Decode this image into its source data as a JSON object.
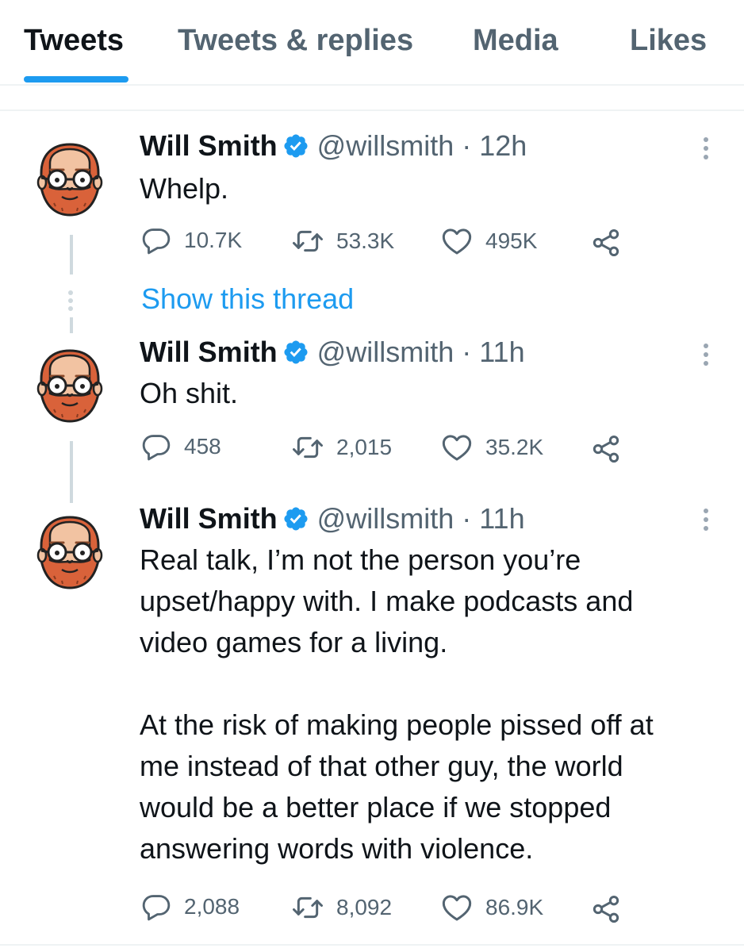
{
  "tabs": [
    "Tweets",
    "Tweets & replies",
    "Media",
    "Likes"
  ],
  "tweets": [
    {
      "name": "Will Smith",
      "handle_time": "@willsmith · 12h",
      "text": "Whelp.",
      "replies": "10.7K",
      "retweets": "53.3K",
      "likes": "495K"
    },
    {
      "name": "Will Smith",
      "handle_time": "@willsmith · 11h",
      "text": "Oh shit.",
      "replies": "458",
      "retweets": "2,015",
      "likes": "35.2K"
    },
    {
      "name": "Will Smith",
      "handle_time": "@willsmith · 11h",
      "text": "Real talk, I’m not the person you’re\nupset/happy with. I make podcasts and\nvideo games for a living.\n\nAt the risk of making people pissed off at\nme instead of that other guy, the world\nwould be a better place if we stopped\nanswering words with violence.",
      "replies": "2,088",
      "retweets": "8,092",
      "likes": "86.9K"
    }
  ],
  "show_thread": "Show this thread",
  "icons": {
    "reply": "reply-icon",
    "retweet": "retweet-icon",
    "like": "heart-icon",
    "share": "share-icon",
    "verified": "verified-badge-icon",
    "more": "more-options-icon"
  },
  "colors": {
    "accent": "#1d9bf0",
    "text": "#0f1419",
    "secondary": "#536471",
    "beard": "#d9623a"
  }
}
